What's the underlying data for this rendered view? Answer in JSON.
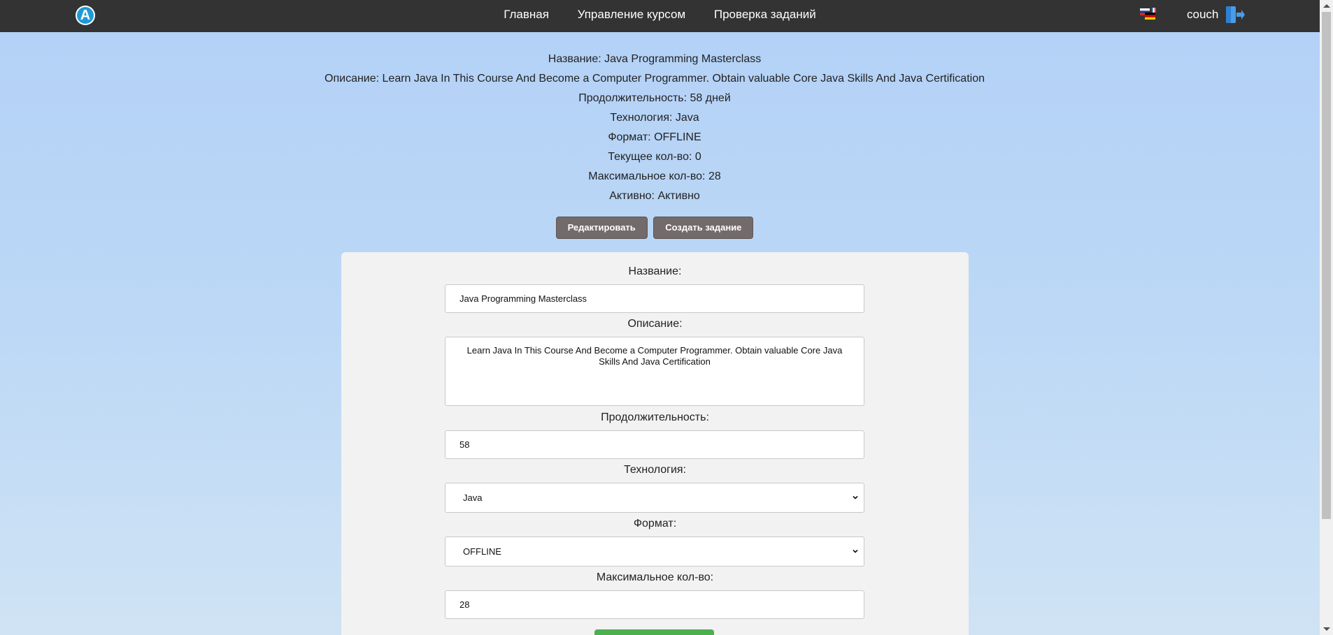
{
  "header": {
    "logo_letter": "A",
    "nav": [
      "Главная",
      "Управление курсом",
      "Проверка заданий"
    ],
    "username": "couch"
  },
  "course_info": {
    "lines": [
      "Название: Java Programming Masterclass",
      "Описание: Learn Java In This Course And Become a Computer Programmer. Obtain valuable Core Java Skills And Java Certification",
      "Продолжительность: 58 дней",
      "Технология: Java",
      "Формат: OFFLINE",
      "Текущее кол-во: 0",
      "Максимальное кол-во: 28",
      "Активно: Активно"
    ]
  },
  "actions": {
    "edit_label": "Редактировать",
    "create_task_label": "Создать задание"
  },
  "form": {
    "name_label": "Название:",
    "name_value": "Java Programming Masterclass",
    "description_label": "Описание:",
    "description_value": "Learn Java In This Course And Become a Computer Programmer. Obtain valuable Core Java Skills And Java Certification",
    "duration_label": "Продолжительность:",
    "duration_value": "58",
    "technology_label": "Технология:",
    "technology_value": "Java",
    "format_label": "Формат:",
    "format_value": "OFFLINE",
    "max_label": "Максимальное кол-во:",
    "max_value": "28"
  },
  "colors": {
    "topbar": "#333333",
    "button": "#736b6b",
    "submit": "#4caf50",
    "logo": "#1d9bd7"
  }
}
